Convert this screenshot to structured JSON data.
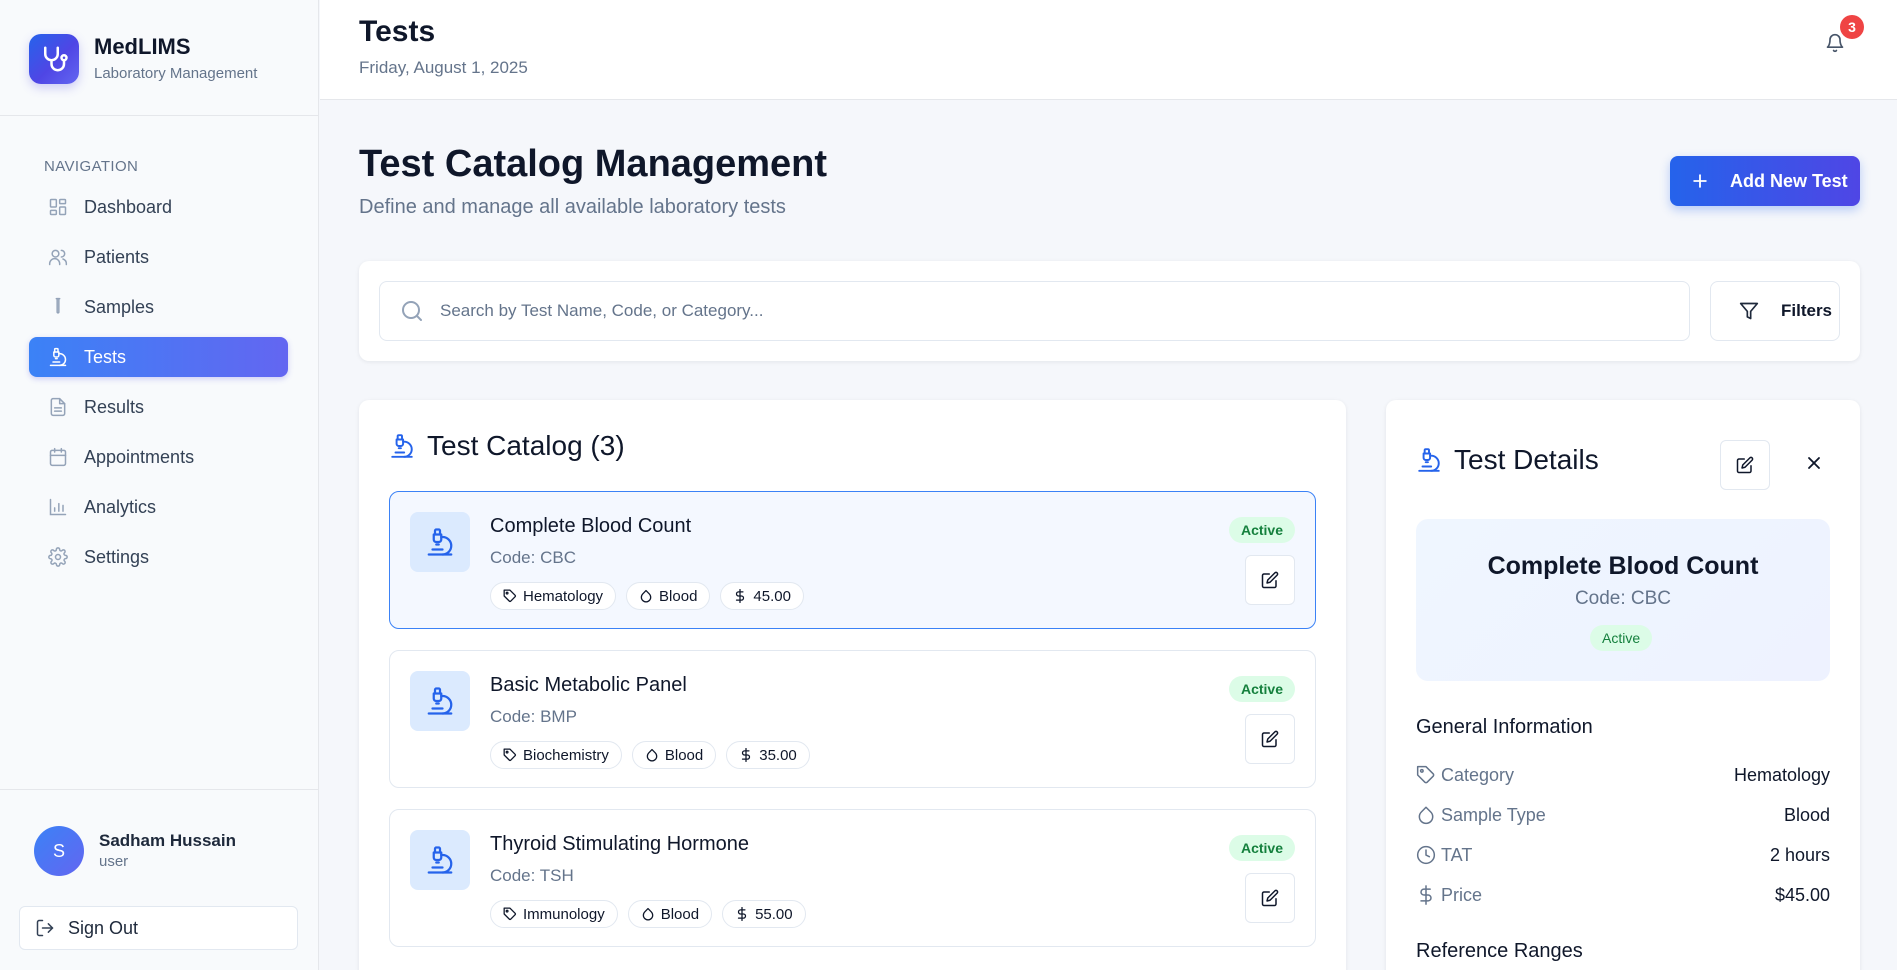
{
  "brand": {
    "name": "MedLIMS",
    "subtitle": "Laboratory Management"
  },
  "nav": {
    "heading": "NAVIGATION",
    "items": [
      {
        "label": "Dashboard",
        "icon": "grid-icon",
        "active": false
      },
      {
        "label": "Patients",
        "icon": "users-icon",
        "active": false
      },
      {
        "label": "Samples",
        "icon": "test-tube-icon",
        "active": false
      },
      {
        "label": "Tests",
        "icon": "microscope-icon",
        "active": true
      },
      {
        "label": "Results",
        "icon": "document-icon",
        "active": false
      },
      {
        "label": "Appointments",
        "icon": "calendar-icon",
        "active": false
      },
      {
        "label": "Analytics",
        "icon": "bar-chart-icon",
        "active": false
      },
      {
        "label": "Settings",
        "icon": "gear-icon",
        "active": false
      }
    ]
  },
  "user": {
    "initial": "S",
    "name": "Sadham Hussain",
    "role": "user"
  },
  "signout": {
    "label": "Sign Out"
  },
  "header": {
    "title": "Tests",
    "date": "Friday, August 1, 2025",
    "notifications": "3"
  },
  "page": {
    "title": "Test Catalog Management",
    "subtitle": "Define and manage all available laboratory tests",
    "add_button": "Add New Test"
  },
  "search": {
    "placeholder": "Search by Test Name, Code, or Category...",
    "value": "",
    "filters_label": "Filters"
  },
  "catalog": {
    "title": "Test Catalog (3)",
    "tests": [
      {
        "name": "Complete Blood Count",
        "code": "Code: CBC",
        "category": "Hematology",
        "sample": "Blood",
        "price": "45.00",
        "status": "Active",
        "selected": true
      },
      {
        "name": "Basic Metabolic Panel",
        "code": "Code: BMP",
        "category": "Biochemistry",
        "sample": "Blood",
        "price": "35.00",
        "status": "Active",
        "selected": false
      },
      {
        "name": "Thyroid Stimulating Hormone",
        "code": "Code: TSH",
        "category": "Immunology",
        "sample": "Blood",
        "price": "55.00",
        "status": "Active",
        "selected": false
      }
    ]
  },
  "details": {
    "title": "Test Details",
    "name": "Complete Blood Count",
    "code": "Code: CBC",
    "status": "Active",
    "general_heading": "General Information",
    "rows": [
      {
        "label": "Category",
        "value": "Hematology",
        "icon": "tag-icon"
      },
      {
        "label": "Sample Type",
        "value": "Blood",
        "icon": "droplet-icon"
      },
      {
        "label": "TAT",
        "value": "2 hours",
        "icon": "clock-icon"
      },
      {
        "label": "Price",
        "value": "$45.00",
        "icon": "dollar-icon"
      }
    ],
    "reference_heading": "Reference Ranges"
  },
  "colors": {
    "accent": "#2563eb",
    "accent_2": "#6366f1",
    "success_bg": "#dcfce7",
    "success_text": "#15803d",
    "danger": "#ef4444"
  }
}
